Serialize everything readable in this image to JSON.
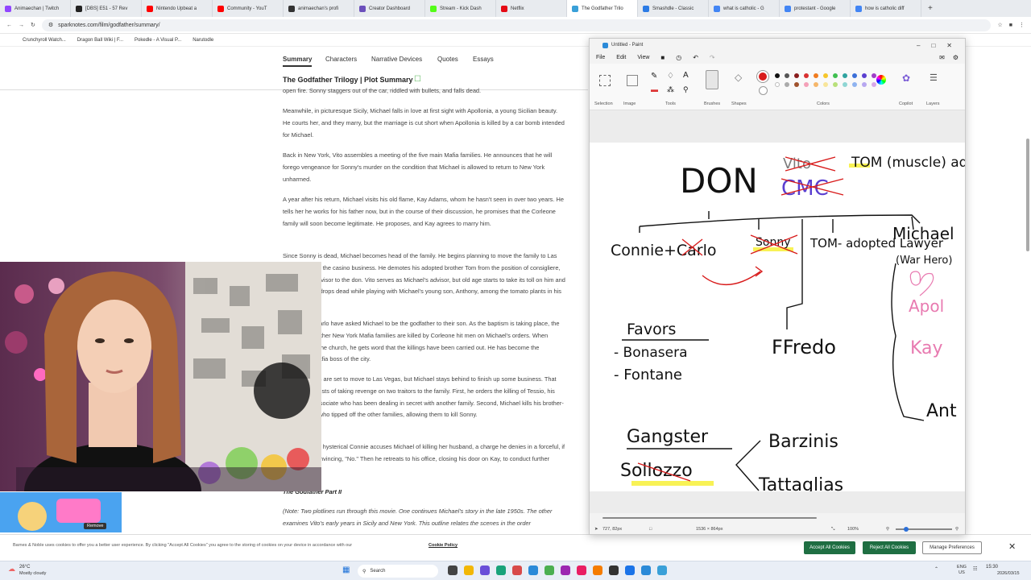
{
  "browser": {
    "tabs": [
      {
        "label": "Animaechan | Twitch",
        "color": "#9146ff",
        "active": false
      },
      {
        "label": "[DBS] E51 - 57 Rev",
        "color": "#222222",
        "active": false
      },
      {
        "label": "Nintendo Upbeat a",
        "color": "#ff0000",
        "active": false
      },
      {
        "label": "Community - YouT",
        "color": "#ff0000",
        "active": false
      },
      {
        "label": "animaechan's profi",
        "color": "#333333",
        "active": false
      },
      {
        "label": "Creator Dashboard",
        "color": "#6b4fbb",
        "active": false
      },
      {
        "label": "Stream - Kick Dash",
        "color": "#53fc18",
        "active": false
      },
      {
        "label": "Netflix",
        "color": "#e50914",
        "active": false
      },
      {
        "label": "The Godfather Trilo",
        "color": "#3aa0d8",
        "active": true
      },
      {
        "label": "Smashdle - Classic",
        "color": "#2c7be5",
        "active": false
      },
      {
        "label": "what is catholic - G",
        "color": "#4285f4",
        "active": false
      },
      {
        "label": "protestant - Google",
        "color": "#4285f4",
        "active": false
      },
      {
        "label": "how is catholic diff",
        "color": "#4285f4",
        "active": false
      }
    ],
    "url": "sparknotes.com/film/godfather/summary/",
    "bookmarks": [
      "Crunchyroll Watch...",
      "Dragon Ball Wiki | F...",
      "Pokedle - A Visual P...",
      "Narutodle"
    ]
  },
  "site": {
    "nav": [
      "Summary",
      "Characters",
      "Narrative Devices",
      "Quotes",
      "Essays"
    ],
    "title": "The Godfather Trilogy | Plot Summary",
    "paragraphs": [
      "open fire. Sonny staggers out of the car, riddled with bullets, and falls dead.",
      "Meanwhile, in picturesque Sicily, Michael falls in love at first sight with Apollonia, a young Sicilian beauty. He courts her, and they marry, but the marriage is cut short when Apollonia is killed by a car bomb intended for Michael.",
      "Back in New York, Vito assembles a meeting of the five main Mafia families. He announces that he will forego vengeance for Sonny's murder on the condition that Michael is allowed to return to New York unharmed.",
      "A year after his return, Michael visits his old flame, Kay Adams, whom he hasn't seen in over two years. He tells her he works for his father now, but in the course of their discussion, he promises that the Corleone family will soon become legitimate. He proposes, and Kay agrees to marry him.",
      "Since Sonny is dead, Michael becomes head of the family. He begins planning to move the family to Las Vegas to enter the casino business. He demotes his adopted brother Tom from the position of consigliere, the primary advisor to the don. Vito serves as Michael's advisor, but old age starts to take its toll on him and he eventually drops dead while playing with Michael's young son, Anthony, among the tomato plants in his backyard.",
      "Connie and Carlo have asked Michael to be the godfather to their son. As the baptism is taking place, the heads of the other New York Mafia families are killed by Corleone hit men on Michael's orders. When Michael exits the church, he gets word that the killings have been carried out. He has become the undisputed Mafia boss of the city.",
      "The Corleones are set to move to Las Vegas, but Michael stays behind to finish up some business. That business consists of taking revenge on two traitors to the family. First, he orders the killing of Tessio, his father's old associate who has been dealing in secret with another family. Second, Michael kills his brother-in-law, Carlo, who tipped off the other families, allowing them to kill Sonny.",
      "Shortly after, a hysterical Connie accuses Michael of killing her husband, a charge he denies in a forceful, if not entirely convincing, \"No.\" Then he retreats to his office, closing his door on Kay, to conduct further business."
    ],
    "part2_heading": "The Godfather Part II",
    "part2_note": "(Note: Two plotlines run through this movie. One continues Michael's story in the late 1950s. The other examines Vito's early years in Sicily and New York. This outline relates the scenes in the order"
  },
  "cookie": {
    "text": "Barnes & Noble uses cookies to offer you a better user experience. By clicking \"Accept All Cookies\" you agree to the storing of cookies on your device in accordance with our",
    "policy_link": "Cookie Policy",
    "accept": "Accept All Cookies",
    "reject": "Reject All Cookies",
    "manage": "Manage Preferences"
  },
  "alert": {
    "remove": "Remove"
  },
  "paint": {
    "title": "Untitled - Paint",
    "menu": [
      "File",
      "Edit",
      "View"
    ],
    "ribbon_labels": [
      "Selection",
      "Image",
      "Tools",
      "Brushes",
      "Shapes",
      "Colors",
      "Copilot",
      "Layers"
    ],
    "status": {
      "cursor": "727, 82px",
      "size": "1536 × 864px",
      "zoom": "100%"
    },
    "colors": [
      "#d81b1b",
      "#111111",
      "#555555",
      "#8a1c1c",
      "#d83030",
      "#f07c1f",
      "#f6c62a",
      "#3fbf50",
      "#2fa3a0",
      "#3b6fd8",
      "#5a3fd0",
      "#9f3fc8"
    ],
    "drawing": {
      "don": "DON",
      "vito_struck": "Vito",
      "tom_advisor": "TOM (muscle) advisor",
      "connie_carlo": "Connie+Carlo",
      "sonny": "Sonny",
      "tom_adopted": "TOM- adopted Lawyer",
      "michael": "Michael",
      "war_hero": "(War Hero)",
      "apol": "Apol",
      "kay": "Kay",
      "fredo": "FFredo",
      "favors": "Favors",
      "bonasera": "- Bonasera",
      "fontane": "- Fontane",
      "gangster": "Gangster",
      "sollozzo": "Sollozzo",
      "barzinis": "Barzinis",
      "tattaglias": "Tattaglias",
      "ant": "Ant"
    }
  },
  "taskbar": {
    "weather_temp": "26°C",
    "weather_desc": "Mostly cloudy",
    "search": "Search",
    "lang": "ENG US",
    "time": "15:30",
    "date": "2026/03/15"
  }
}
